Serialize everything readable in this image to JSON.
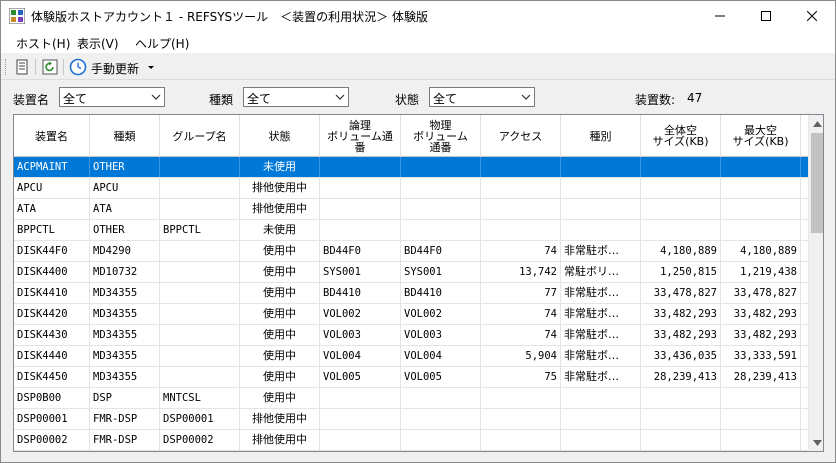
{
  "window": {
    "title": "体験版ホストアカウント１ - REFSYSツール　＜装置の利用状況＞ 体験版"
  },
  "menu": [
    {
      "label": "ホスト(H)"
    },
    {
      "label": "表示(V)"
    },
    {
      "label": "ヘルプ(H)"
    }
  ],
  "toolbar": {
    "refresh_label": "手動更新"
  },
  "filters": {
    "device_name_label": "装置名",
    "device_name_value": "全て",
    "type_label": "種類",
    "type_value": "全て",
    "status_label": "状態",
    "status_value": "全て",
    "count_label": "装置数:",
    "count_value": "47"
  },
  "table": {
    "columns": [
      "装置名",
      "種類",
      "グループ名",
      "状態",
      "論理\nボリューム通\n番",
      "物理\nボリューム\n通番",
      "アクセス",
      "種別",
      "全体空\nサイズ(KB)",
      "最大空\nサイズ(KB)"
    ],
    "rows": [
      [
        "ACPMAINT",
        "OTHER",
        "",
        "未使用",
        "",
        "",
        "",
        "",
        "",
        ""
      ],
      [
        "APCU",
        "APCU",
        "",
        "排他使用中",
        "",
        "",
        "",
        "",
        "",
        ""
      ],
      [
        "ATA",
        "ATA",
        "",
        "排他使用中",
        "",
        "",
        "",
        "",
        "",
        ""
      ],
      [
        "BPPCTL",
        "OTHER",
        "BPPCTL",
        "未使用",
        "",
        "",
        "",
        "",
        "",
        ""
      ],
      [
        "DISK44F0",
        "MD4290",
        "",
        "使用中",
        "BD44F0",
        "BD44F0",
        "74",
        "非常駐ボ…",
        "4,180,889",
        "4,180,889"
      ],
      [
        "DISK4400",
        "MD10732",
        "",
        "使用中",
        "SYS001",
        "SYS001",
        "13,742",
        "常駐ボリ…",
        "1,250,815",
        "1,219,438"
      ],
      [
        "DISK4410",
        "MD34355",
        "",
        "使用中",
        "BD4410",
        "BD4410",
        "77",
        "非常駐ボ…",
        "33,478,827",
        "33,478,827"
      ],
      [
        "DISK4420",
        "MD34355",
        "",
        "使用中",
        "VOL002",
        "VOL002",
        "74",
        "非常駐ボ…",
        "33,482,293",
        "33,482,293"
      ],
      [
        "DISK4430",
        "MD34355",
        "",
        "使用中",
        "VOL003",
        "VOL003",
        "74",
        "非常駐ボ…",
        "33,482,293",
        "33,482,293"
      ],
      [
        "DISK4440",
        "MD34355",
        "",
        "使用中",
        "VOL004",
        "VOL004",
        "5,904",
        "非常駐ボ…",
        "33,436,035",
        "33,333,591"
      ],
      [
        "DISK4450",
        "MD34355",
        "",
        "使用中",
        "VOL005",
        "VOL005",
        "75",
        "非常駐ボ…",
        "28,239,413",
        "28,239,413"
      ],
      [
        "DSP0B00",
        "DSP",
        "MNTCSL",
        "使用中",
        "",
        "",
        "",
        "",
        "",
        ""
      ],
      [
        "DSP00001",
        "FMR-DSP",
        "DSP00001",
        "排他使用中",
        "",
        "",
        "",
        "",
        "",
        ""
      ],
      [
        "DSP00002",
        "FMR-DSP",
        "DSP00002",
        "排他使用中",
        "",
        "",
        "",
        "",
        "",
        ""
      ]
    ],
    "selected_row": 0
  },
  "colors": {
    "selection": "#0078d7",
    "accent_icon": "#1e6fd9"
  },
  "icons": {
    "app": "app-icon",
    "toolbar_doc": "document-icon",
    "toolbar_refresh": "refresh-icon",
    "toolbar_clock": "clock-icon",
    "dropdown": "chevron-down-icon"
  }
}
